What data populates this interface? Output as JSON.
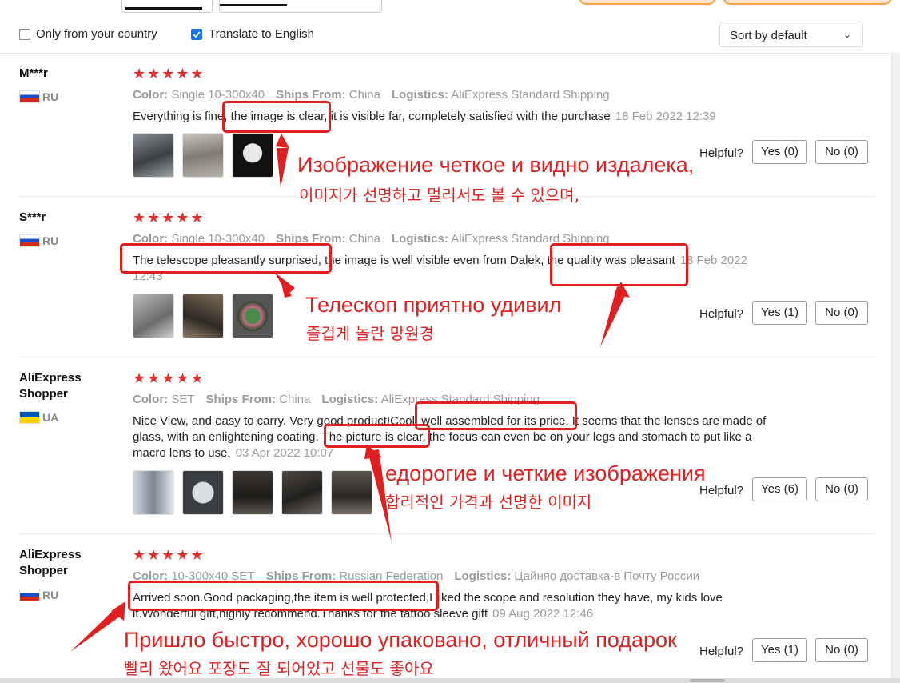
{
  "filters": {
    "only_country_label": "Only from your country",
    "translate_label": "Translate to English",
    "sort_value": "Sort by default"
  },
  "labels": {
    "color": "Color:",
    "ships_from": "Ships From:",
    "logistics": "Logistics:",
    "helpful": "Helpful?"
  },
  "reviews": [
    {
      "user": "M***r",
      "country": "RU",
      "stars": "★★★★★",
      "color": "Single 10-300x40",
      "ships_from": "China",
      "logistics": "AliExpress Standard Shipping",
      "text": "Everything is fine, the image is clear, it is visible far, completely satisfied with the purchase",
      "date": "18 Feb 2022 12:39",
      "yes": "Yes (0)",
      "no": "No (0)"
    },
    {
      "user": "S***r",
      "country": "RU",
      "stars": "★★★★★",
      "color": "Single 10-300x40",
      "ships_from": "China",
      "logistics": "AliExpress Standard Shipping",
      "text": "The telescope pleasantly surprised, the image is well visible even from Dalek, the quality was pleasant",
      "date": "18 Feb 2022 12:43",
      "yes": "Yes (1)",
      "no": "No (0)"
    },
    {
      "user": "AliExpress Shopper",
      "country": "UA",
      "stars": "★★★★★",
      "color": "SET",
      "ships_from": "China",
      "logistics": "AliExpress Standard Shipping",
      "text": "Nice View, and easy to carry. Very good product!Cool, well assembled for its price. It seems that the lenses are made of glass, with an enlightening coating. The picture is clear, the focus can even be on your legs and stomach to put like a macro lens to use.",
      "date": "03 Apr 2022 10:07",
      "yes": "Yes (6)",
      "no": "No (0)"
    },
    {
      "user": "AliExpress Shopper",
      "country": "RU",
      "stars": "★★★★★",
      "color": "10-300x40 SET",
      "ships_from": "Russian Federation",
      "logistics": "Цайняо доставка-в Почту России",
      "text": "Arrived soon.Good packaging,the item is well protected,I liked the scope and resolution they have, my kids love it.Wonderful gift,highly recommend.Thanks for the tattoo sleeve gift",
      "date": "09 Aug 2022 12:46",
      "yes": "Yes (1)",
      "no": "No (0)"
    }
  ],
  "annotations": [
    {
      "ru": "Изображение четкое и видно издалека,",
      "ko": "이미지가 선명하고 멀리서도 볼 수 있으며,"
    },
    {
      "ru": "Телескоп приятно удивил",
      "ko": "즐겁게 놀란 망원경"
    },
    {
      "ru": "едорогие и четкие изображения",
      "ko": "합리적인 가격과 선명한 이미지"
    },
    {
      "ru": "Пришло быстро, хорошо упаковано, отличный подарок",
      "ko": "빨리 왔어요 포장도 잘 되어있고 선물도 좋아요"
    }
  ],
  "colors": {
    "accent_red": "#e02020",
    "star_red": "#e62e2e",
    "check_blue": "#1a73e8"
  }
}
